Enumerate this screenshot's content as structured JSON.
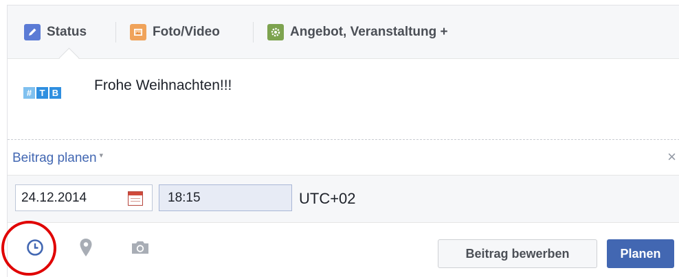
{
  "tabs": [
    {
      "label": "Status",
      "icon": "pencil-icon",
      "color": "#5b7bd5"
    },
    {
      "label": "Foto/Video",
      "icon": "photo-icon",
      "color": "#f0a35a"
    },
    {
      "label": "Angebot, Veranstaltung +",
      "icon": "settings-icon",
      "color": "#7da34f"
    }
  ],
  "post": {
    "text": "Frohe Weihnachten!!!",
    "avatar": [
      "#",
      "T",
      "B"
    ]
  },
  "schedule": {
    "label": "Beitrag planen",
    "caret": "▾",
    "close": "×",
    "date": "24.12.2014",
    "time": "18:15",
    "timezone": "UTC+02"
  },
  "footer": {
    "icons": [
      "clock-icon",
      "location-pin-icon",
      "camera-icon"
    ],
    "promote_label": "Beitrag bewerben",
    "plan_label": "Planen"
  },
  "colors": {
    "accent": "#4267b2",
    "highlight_circle": "#e00000"
  }
}
